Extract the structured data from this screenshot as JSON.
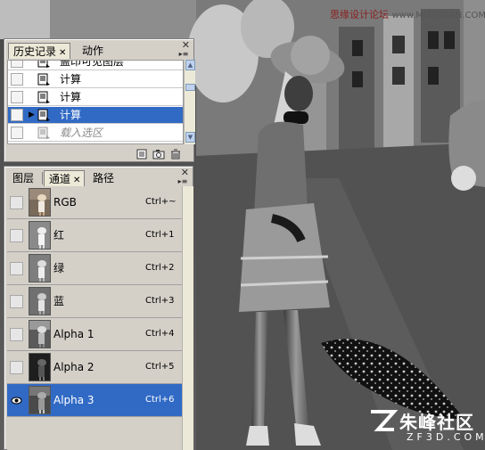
{
  "colors": {
    "panel_bg": "#d4d0c8",
    "selection": "#316ac5",
    "selection_text": "#ffffff"
  },
  "watermark_top": {
    "text": "思缘设计论坛",
    "site": "www.MISSYUAN.COM"
  },
  "watermark_bottom": {
    "brand": "朱峰社区",
    "site": "ZF3D.COM"
  },
  "history_panel": {
    "tabs": [
      {
        "label": "历史记录",
        "active": true,
        "closable": true
      },
      {
        "label": "动作",
        "active": false,
        "closable": false
      }
    ],
    "items": [
      {
        "label": "盖印可见图层",
        "icon": "history-state-icon",
        "selected": false,
        "dimmed": false
      },
      {
        "label": "计算",
        "icon": "history-state-icon",
        "selected": false,
        "dimmed": false
      },
      {
        "label": "计算",
        "icon": "history-state-icon",
        "selected": false,
        "dimmed": false
      },
      {
        "label": "计算",
        "icon": "history-state-icon",
        "selected": true,
        "dimmed": false
      },
      {
        "label": "载入选区",
        "icon": "history-state-icon",
        "selected": false,
        "dimmed": true
      }
    ],
    "footer_icons": [
      "new-document-from-state-icon",
      "new-snapshot-icon",
      "trash-icon"
    ]
  },
  "channels_panel": {
    "tabs": [
      {
        "label": "图层",
        "active": false,
        "closable": false
      },
      {
        "label": "通道",
        "active": true,
        "closable": true
      },
      {
        "label": "路径",
        "active": false,
        "closable": false
      }
    ],
    "channels": [
      {
        "name": "RGB",
        "shortcut": "Ctrl+~",
        "visible": false,
        "selected": false
      },
      {
        "name": "红",
        "shortcut": "Ctrl+1",
        "visible": false,
        "selected": false
      },
      {
        "name": "绿",
        "shortcut": "Ctrl+2",
        "visible": false,
        "selected": false
      },
      {
        "name": "蓝",
        "shortcut": "Ctrl+3",
        "visible": false,
        "selected": false
      },
      {
        "name": "Alpha 1",
        "shortcut": "Ctrl+4",
        "visible": false,
        "selected": false
      },
      {
        "name": "Alpha 2",
        "shortcut": "Ctrl+5",
        "visible": false,
        "selected": false
      },
      {
        "name": "Alpha 3",
        "shortcut": "Ctrl+6",
        "visible": true,
        "selected": true
      }
    ]
  }
}
